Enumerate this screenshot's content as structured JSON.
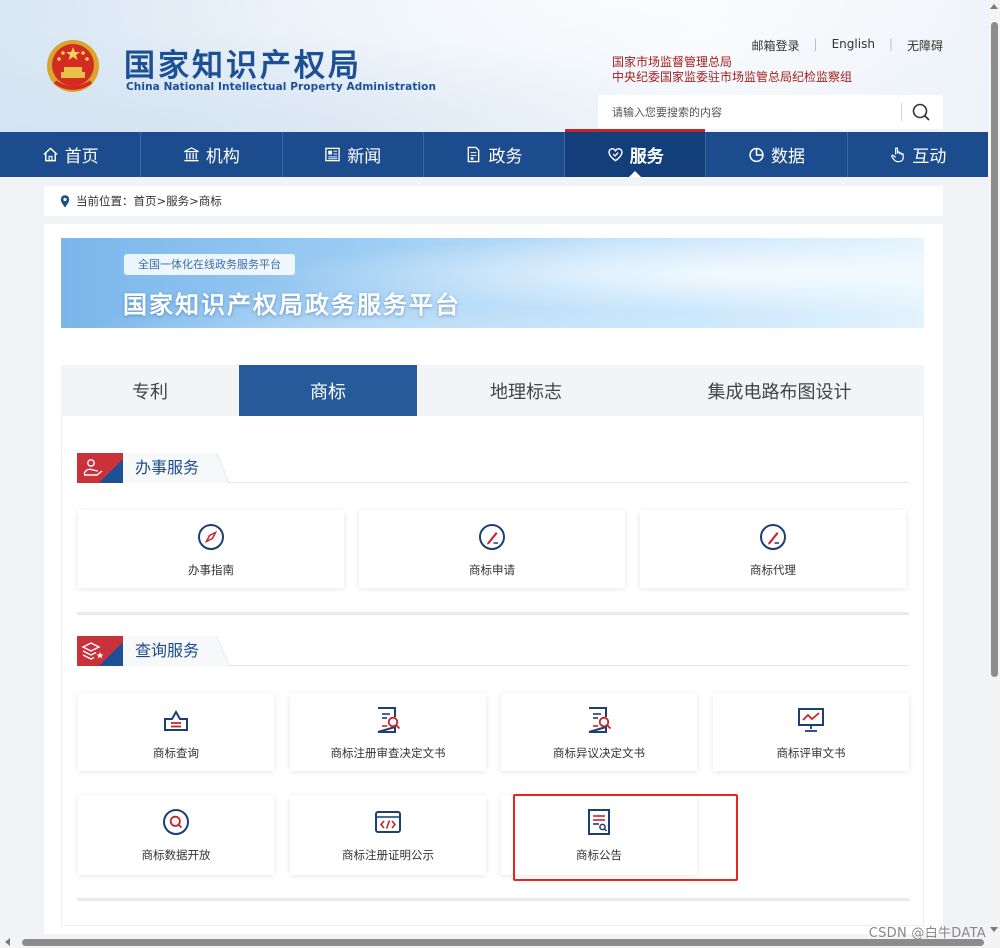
{
  "header": {
    "logo_cn": "国家知识产权局",
    "logo_en": "China National Intellectual Property Administration",
    "top_links": [
      "邮箱登录",
      "English",
      "无障碍"
    ],
    "agencies": [
      "国家市场监督管理总局",
      "中央纪委国家监委驻市场监管总局纪检监察组"
    ],
    "search_placeholder": "请输入您要搜索的内容"
  },
  "nav": [
    {
      "label": "首页",
      "icon": "home-icon"
    },
    {
      "label": "机构",
      "icon": "building-icon"
    },
    {
      "label": "新闻",
      "icon": "newspaper-icon"
    },
    {
      "label": "政务",
      "icon": "document-icon"
    },
    {
      "label": "服务",
      "icon": "service-heart-icon",
      "active": true
    },
    {
      "label": "数据",
      "icon": "pie-chart-icon"
    },
    {
      "label": "互动",
      "icon": "hand-pointer-icon"
    }
  ],
  "breadcrumb": "当前位置：首页>服务>商标",
  "banner": {
    "chip": "全国一体化在线政务服务平台",
    "title": "国家知识产权局政务服务平台"
  },
  "tabs": [
    {
      "label": "专利"
    },
    {
      "label": "商标",
      "active": true
    },
    {
      "label": "地理标志"
    },
    {
      "label": "集成电路布图设计"
    }
  ],
  "sections": {
    "handling": {
      "title": "办事服务",
      "cards": [
        {
          "label": "办事指南",
          "icon": "compass-icon"
        },
        {
          "label": "商标申请",
          "icon": "pen-badge-icon"
        },
        {
          "label": "商标代理",
          "icon": "pen-badge-icon"
        }
      ]
    },
    "query": {
      "title": "查询服务",
      "cards": [
        {
          "label": "商标查询",
          "icon": "inbox-tray-icon"
        },
        {
          "label": "商标注册审查决定文书",
          "icon": "document-search-icon"
        },
        {
          "label": "商标异议决定文书",
          "icon": "document-search-icon"
        },
        {
          "label": "商标评审文书",
          "icon": "presentation-chart-icon"
        },
        {
          "label": "商标数据开放",
          "icon": "search-circle-icon"
        },
        {
          "label": "商标注册证明公示",
          "icon": "code-window-icon"
        },
        {
          "label": "商标公告",
          "icon": "announcement-document-icon"
        }
      ]
    }
  },
  "watermark": "CSDN @白牛DATA",
  "colors": {
    "nav_bg": "#1c4c8d",
    "tab_active": "#275a9a",
    "accent_red": "#c6242a",
    "highlight": "#e8261c"
  }
}
